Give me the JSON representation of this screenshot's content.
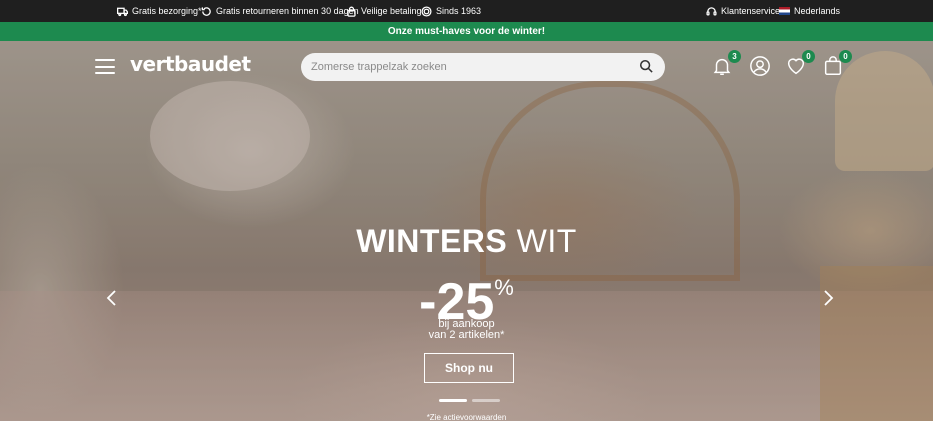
{
  "topbar": {
    "items": [
      {
        "label": "Gratis bezorging*",
        "icon": "truck-icon"
      },
      {
        "label": "Gratis retourneren binnen 30 dagen",
        "icon": "return-icon"
      },
      {
        "label": "Veilige betaling",
        "icon": "lock-icon"
      },
      {
        "label": "Sinds 1963",
        "icon": "medal-icon"
      }
    ],
    "service": {
      "label": "Klantenservice",
      "icon": "headset-icon"
    },
    "language": {
      "label": "Nederlands",
      "icon": "flag-nl-icon"
    }
  },
  "promo": {
    "text": "Onze must-haves voor de winter!"
  },
  "header": {
    "logo": "vertbaudet",
    "search_placeholder": "Zomerse trappelzak zoeken",
    "notifications_count": "3",
    "wishlist_count": "0",
    "cart_count": "0"
  },
  "hero": {
    "headline_bold": "WINTERS",
    "headline_regular": "WIT",
    "discount": "-25",
    "discount_unit": "%",
    "sub_line1": "bij aankoop",
    "sub_line2": "van 2 artikelen*",
    "cta": "Shop nu",
    "footnote": "*Zie actievoorwaarden",
    "active_slide": 1,
    "slide_count": 2
  },
  "colors": {
    "accent": "#1d8a4f",
    "topbar": "#1f1f1f"
  }
}
